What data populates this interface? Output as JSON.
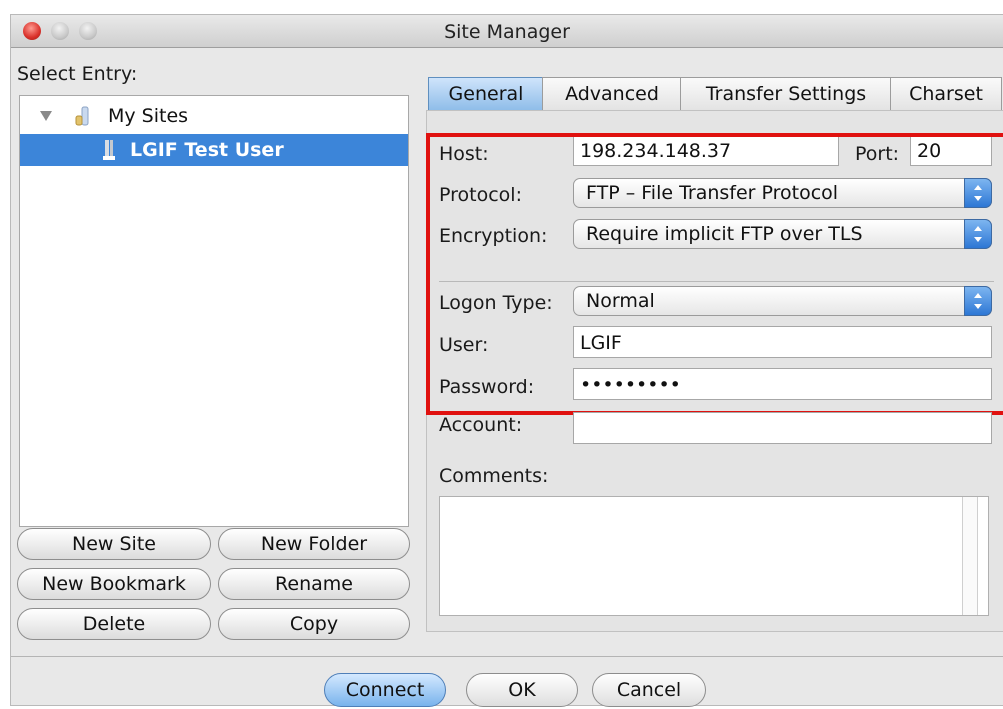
{
  "window": {
    "title": "Site Manager"
  },
  "left_pane": {
    "select_entry_label": "Select Entry:",
    "tree": [
      {
        "label": "My Sites",
        "type": "folder",
        "expanded": true
      },
      {
        "label": "LGIF Test User",
        "type": "site",
        "selected": true
      }
    ],
    "buttons": {
      "new_site": "New Site",
      "new_folder": "New Folder",
      "new_bookmark": "New Bookmark",
      "rename": "Rename",
      "delete": "Delete",
      "copy": "Copy"
    }
  },
  "tabs": [
    {
      "label": "General",
      "active": true
    },
    {
      "label": "Advanced"
    },
    {
      "label": "Transfer Settings"
    },
    {
      "label": "Charset"
    }
  ],
  "general": {
    "host_label": "Host:",
    "host_value": "198.234.148.37",
    "port_label": "Port:",
    "port_value": "20",
    "protocol_label": "Protocol:",
    "protocol_value": "FTP – File Transfer Protocol",
    "encryption_label": "Encryption:",
    "encryption_value": "Require implicit FTP over TLS",
    "logon_type_label": "Logon Type:",
    "logon_type_value": "Normal",
    "user_label": "User:",
    "user_value": "LGIF",
    "password_label": "Password:",
    "password_value": "•••••••••",
    "account_label": "Account:",
    "account_value": "",
    "comments_label": "Comments:",
    "comments_value": ""
  },
  "footer": {
    "connect": "Connect",
    "ok": "OK",
    "cancel": "Cancel"
  },
  "colors": {
    "highlight_border": "#e0110f",
    "selection": "#3c85d9"
  }
}
